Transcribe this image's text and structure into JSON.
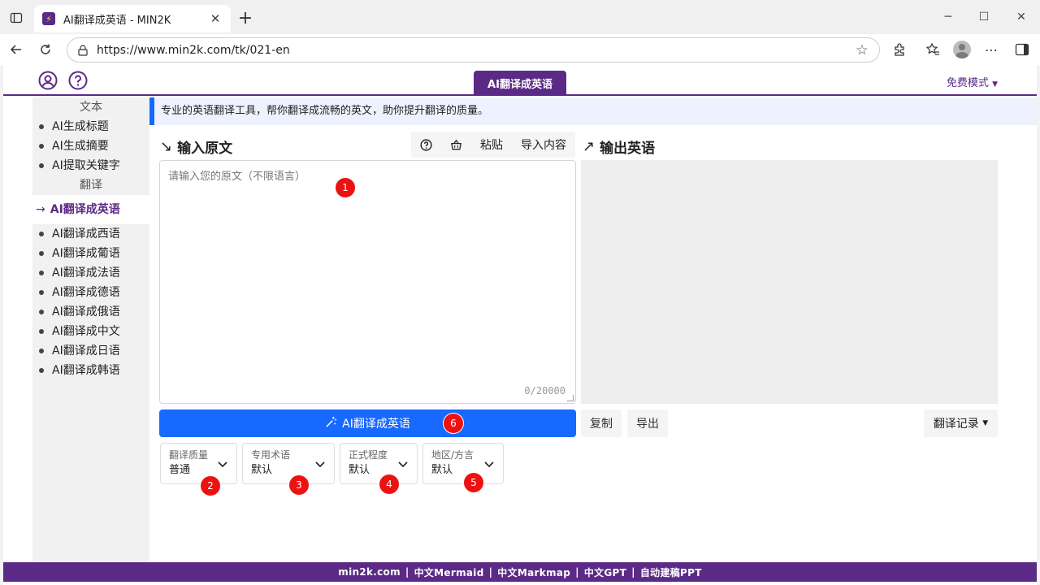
{
  "browser": {
    "tab_title": "AI翻译成英语 - MIN2K",
    "url": "https://www.min2k.com/tk/021-en"
  },
  "header": {
    "active_tab": "AI翻译成英语",
    "mode": "免费模式"
  },
  "sidebar": {
    "group_text": "文本",
    "text_items": [
      "AI生成标题",
      "AI生成摘要",
      "AI提取关键字"
    ],
    "group_translate": "翻译",
    "active_item": "AI翻译成英语",
    "translate_items": [
      "AI翻译成西语",
      "AI翻译成葡语",
      "AI翻译成法语",
      "AI翻译成德语",
      "AI翻译成俄语",
      "AI翻译成中文",
      "AI翻译成日语",
      "AI翻译成韩语"
    ]
  },
  "banner": "专业的英语翻译工具，帮你翻译成流畅的英文，助你提升翻译的质量。",
  "input": {
    "title": "输入原文",
    "paste_label": "粘贴",
    "import_label": "导入内容",
    "placeholder": "请输入您的原文（不限语言）",
    "counter": "0/20000"
  },
  "output": {
    "title": "输出英语",
    "copy_label": "复制",
    "export_label": "导出",
    "history_label": "翻译记录"
  },
  "translate_button": "AI翻译成英语",
  "options": [
    {
      "label": "翻译质量",
      "value": "普通"
    },
    {
      "label": "专用术语",
      "value": "默认"
    },
    {
      "label": "正式程度",
      "value": "默认"
    },
    {
      "label": "地区/方言",
      "value": "默认"
    }
  ],
  "badges": [
    "1",
    "2",
    "3",
    "4",
    "5",
    "6"
  ],
  "footer": [
    "min2k.com",
    "中文Mermaid",
    "中文Markmap",
    "中文GPT",
    "自动建稿PPT"
  ],
  "footer_sep": "|"
}
